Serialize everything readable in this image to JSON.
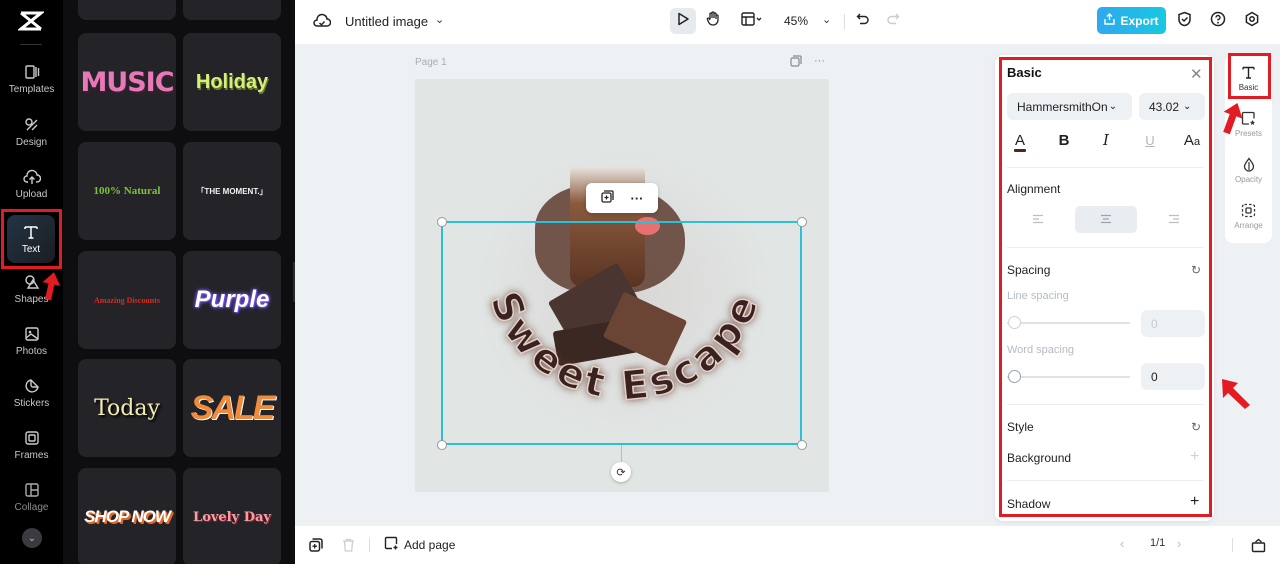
{
  "app": {
    "logo": "capcut-logo-icon"
  },
  "rail": {
    "items": [
      {
        "label": "Templates",
        "icon": "templates-icon"
      },
      {
        "label": "Design",
        "icon": "design-icon"
      },
      {
        "label": "Upload",
        "icon": "upload-icon"
      },
      {
        "label": "Text",
        "icon": "text-icon",
        "active": true
      },
      {
        "label": "Shapes",
        "icon": "shapes-icon"
      },
      {
        "label": "Photos",
        "icon": "photos-icon"
      },
      {
        "label": "Stickers",
        "icon": "stickers-icon"
      },
      {
        "label": "Frames",
        "icon": "frames-icon"
      },
      {
        "label": "Collage",
        "icon": "collage-icon"
      }
    ],
    "expand_icon": "chevron-down-icon"
  },
  "text_panel": {
    "presets": [
      {
        "label": "MUSIC",
        "color": "#e879b9"
      },
      {
        "label": "Holiday",
        "color": "#d4f07a"
      },
      {
        "label": "100% Natural",
        "color": "#7fc23a"
      },
      {
        "label": "「THE MOMENT.」",
        "color": "#f2f2f2"
      },
      {
        "label": "Amazing Discounts",
        "color": "#e0281e"
      },
      {
        "label": "Purple",
        "color": "#7a5af5"
      },
      {
        "label": "Today",
        "color": "#f1ebb6"
      },
      {
        "label": "SALE",
        "color": "#f08a3c"
      },
      {
        "label": "SHOP NOW",
        "color": "#ffffff"
      },
      {
        "label": "Lovely Day",
        "color": "#f1a0a8"
      }
    ]
  },
  "topbar": {
    "title": "Untitled image",
    "zoom": "45%",
    "export_label": "Export",
    "accent": "#1fb6e8"
  },
  "canvas": {
    "page_label": "Page 1",
    "curved_text": "Sweet Escape"
  },
  "bottombar": {
    "add_page_label": "Add page",
    "pager": "1/1"
  },
  "props": {
    "title": "Basic",
    "font": "HammersmithOn",
    "size": "43.02",
    "alignment_label": "Alignment",
    "spacing_label": "Spacing",
    "line_spacing_label": "Line spacing",
    "line_spacing_value": "0",
    "word_spacing_label": "Word spacing",
    "word_spacing_value": "0",
    "style_label": "Style",
    "background_label": "Background",
    "shadow_label": "Shadow",
    "text_color": "#4a2a20"
  },
  "right_tabs": [
    {
      "label": "Basic",
      "icon": "text-icon",
      "active": true
    },
    {
      "label": "Presets",
      "icon": "presets-icon"
    },
    {
      "label": "Opacity",
      "icon": "opacity-icon"
    },
    {
      "label": "Arrange",
      "icon": "arrange-icon"
    }
  ],
  "annotations": {
    "highlight_color": "#e31b23"
  }
}
